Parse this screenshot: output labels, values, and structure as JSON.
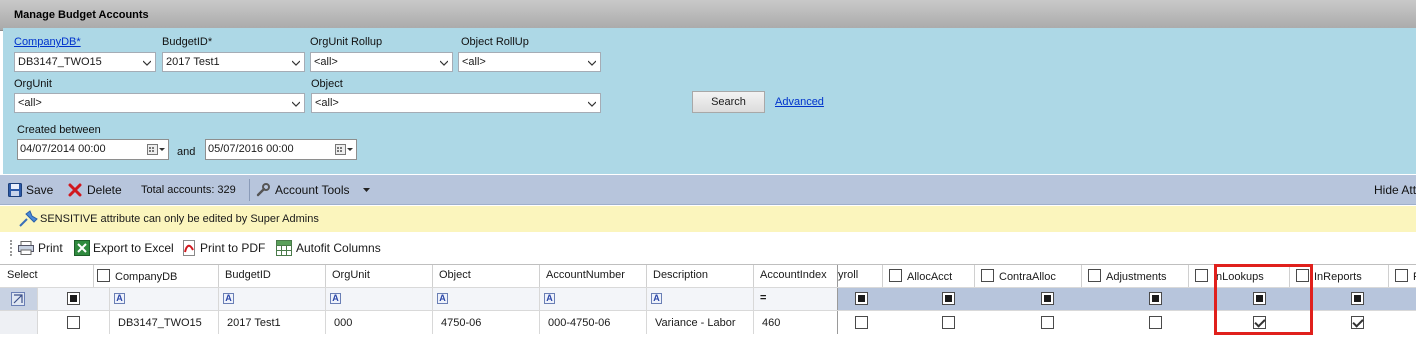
{
  "window": {
    "title": "Manage Budget Accounts"
  },
  "filters": {
    "company_db_label": "CompanyDB*",
    "company_db_value": "DB3147_TWO15",
    "budget_id_label": "BudgetID*",
    "budget_id_value": "2017 Test1",
    "orgunit_rollup_label": "OrgUnit Rollup",
    "orgunit_rollup_value": "<all>",
    "object_rollup_label": "Object RollUp",
    "object_rollup_value": "<all>",
    "orgunit_label": "OrgUnit",
    "orgunit_value": "<all>",
    "object_label": "Object",
    "object_value": "<all>",
    "search_label": "Search",
    "advanced_label": "Advanced",
    "created_between_label": "Created between",
    "date_from": "04/07/2014  00:00",
    "and_label": "and",
    "date_to": "05/07/2016  00:00"
  },
  "toolbar": {
    "save_label": "Save",
    "delete_label": "Delete",
    "total_accounts": "Total accounts: 329",
    "account_tools_label": "Account Tools",
    "hide_label": "Hide Att"
  },
  "notice": {
    "text": "SENSITIVE attribute can only be edited by Super Admins"
  },
  "grid_tools": {
    "print_label": "Print",
    "export_label": "Export to Excel",
    "pdf_label": "Print to PDF",
    "autofit_label": "Autofit Columns"
  },
  "grid": {
    "headers": {
      "select": "Select",
      "company_db": "CompanyDB",
      "budget_id": "BudgetID",
      "orgunit": "OrgUnit",
      "object": "Object",
      "account_number": "AccountNumber",
      "description": "Description",
      "account_index": "AccountIndex",
      "payroll": "yroll",
      "alloc_acct": "AllocAcct",
      "contra_alloc": "ContraAlloc",
      "adjustments": "Adjustments",
      "in_lookups": "InLookups",
      "in_reports": "InReports",
      "last": "R"
    },
    "filter_equals": "=",
    "row": {
      "company_db": "DB3147_TWO15",
      "budget_id": "2017 Test1",
      "orgunit": "000",
      "object": "4750-06",
      "account_number": "000-4750-06",
      "description": "Variance - Labor",
      "account_index": "460",
      "in_lookups": true,
      "in_reports": true
    }
  },
  "colors": {
    "panel": "#add8e6",
    "toolbar": "#b7c5dc",
    "notice": "#fbf5bd",
    "highlight": "#e0201c"
  }
}
